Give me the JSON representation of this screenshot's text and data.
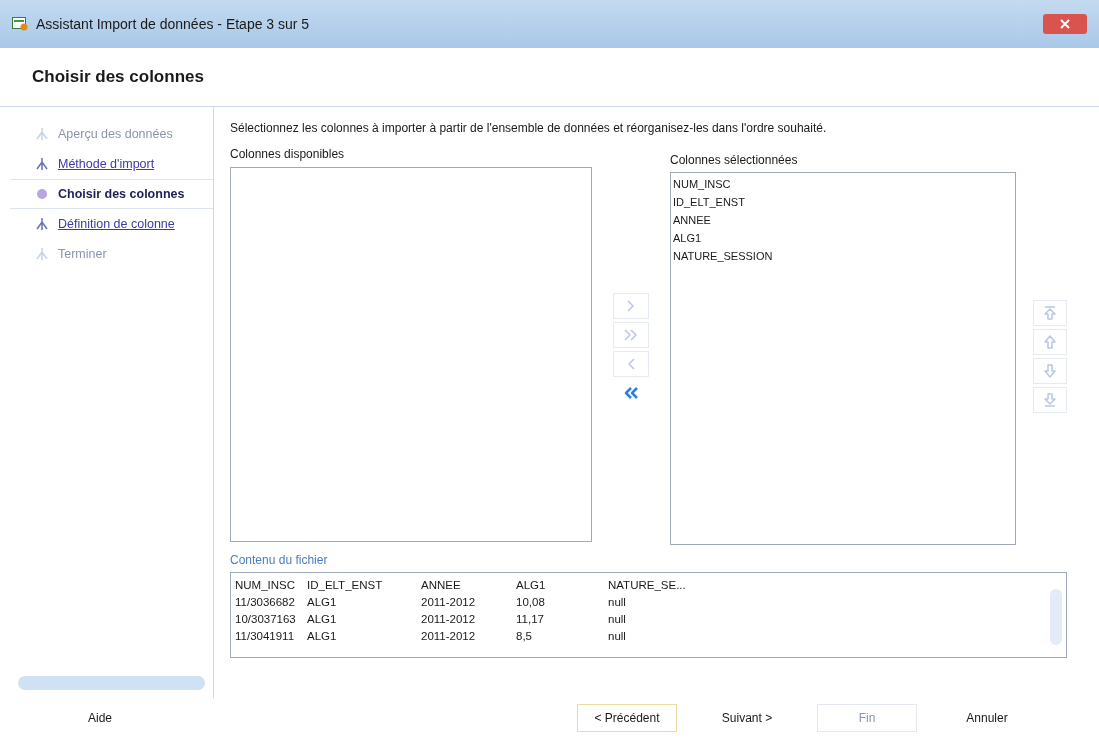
{
  "window": {
    "title": "Assistant Import de données - Etape 3 sur 5"
  },
  "header": {
    "title": "Choisir des colonnes"
  },
  "steps": [
    {
      "label": "Aperçu des données",
      "selected": false,
      "disabled": true
    },
    {
      "label": "Méthode d'import",
      "selected": false,
      "disabled": false
    },
    {
      "label": "Choisir des colonnes",
      "selected": true,
      "disabled": false
    },
    {
      "label": "Définition de colonne",
      "selected": false,
      "disabled": false
    },
    {
      "label": "Terminer",
      "selected": false,
      "disabled": true
    }
  ],
  "instruction": "Sélectionnez les colonnes à importer à partir de l'ensemble de données et réorganisez-les dans l'ordre souhaité.",
  "available": {
    "label": "Colonnes disponibles"
  },
  "transfer_buttons": [
    {
      "kind": "add",
      "disabled": true
    },
    {
      "kind": "add_all",
      "disabled": true
    },
    {
      "kind": "remove",
      "disabled": true
    },
    {
      "kind": "remove_all",
      "disabled": false
    }
  ],
  "selected": {
    "label": "Colonnes sélectionnées",
    "items": [
      "NUM_INSC",
      "ID_ELT_ENST",
      "ANNEE",
      "ALG1",
      "NATURE_SESSION"
    ]
  },
  "order_buttons": [
    {
      "kind": "top",
      "disabled": true
    },
    {
      "kind": "up",
      "disabled": true
    },
    {
      "kind": "down",
      "disabled": true
    },
    {
      "kind": "bottom",
      "disabled": true
    }
  ],
  "file_content": {
    "label": "Contenu du fichier",
    "columns": [
      "NUM_INSC",
      "ID_ELT_ENST",
      "ANNEE",
      "ALG1",
      "NATURE_SE..."
    ],
    "rows": [
      [
        "11/3036682",
        "ALG1",
        "2011-2012",
        "10,08",
        "null"
      ],
      [
        "10/3037163",
        "ALG1",
        "2011-2012",
        "11,17",
        "null"
      ],
      [
        "11/3041911",
        "ALG1",
        "2011-2012",
        "8,5",
        "null"
      ]
    ]
  },
  "footer": {
    "help": "Aide",
    "buttons": [
      {
        "label": "< Précédent",
        "disabled": false
      },
      {
        "label": "Suivant >",
        "disabled": false
      },
      {
        "label": "Fin",
        "disabled": true
      },
      {
        "label": "Annuler",
        "disabled": false
      }
    ]
  }
}
